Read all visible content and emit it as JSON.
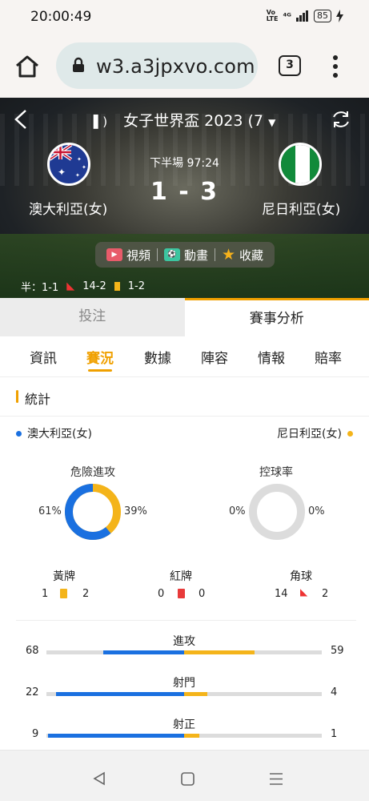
{
  "status_bar": {
    "time": "20:00:49",
    "network": "4G",
    "battery": "85"
  },
  "browser": {
    "url": "w3.a3jpxvo.com",
    "tab_count": "3"
  },
  "match": {
    "league": "女子世界盃 2023 (7",
    "period": "下半場  97:24",
    "home": {
      "name": "澳大利亞(女)"
    },
    "away": {
      "name": "尼日利亞(女)"
    },
    "score": "1 - 3",
    "actions": {
      "video": "視頻",
      "animation": "動畫",
      "favorite": "收藏"
    },
    "summary": {
      "half": "半：1-1",
      "corners": "14-2",
      "cards": "1-2"
    }
  },
  "section_tabs": [
    {
      "label": "投注"
    },
    {
      "label": "賽事分析"
    }
  ],
  "sub_tabs": [
    {
      "label": "資訊"
    },
    {
      "label": "賽況"
    },
    {
      "label": "數據"
    },
    {
      "label": "陣容"
    },
    {
      "label": "情報"
    },
    {
      "label": "賠率"
    }
  ],
  "stats": {
    "title": "統計",
    "home_label": "澳大利亞(女)",
    "away_label": "尼日利亞(女)",
    "danger_attack": {
      "label": "危險進攻",
      "home": "61%",
      "away": "39%",
      "home_frac": 0.61
    },
    "possession": {
      "label": "控球率",
      "home": "0%",
      "away": "0%"
    },
    "yellow": {
      "label": "黃牌",
      "home": "1",
      "away": "2"
    },
    "red": {
      "label": "紅牌",
      "home": "0",
      "away": "0"
    },
    "corner": {
      "label": "角球",
      "home": "14",
      "away": "2"
    },
    "bars": [
      {
        "label": "進攻",
        "home": "68",
        "away": "59",
        "home_v": 68,
        "away_v": 59
      },
      {
        "label": "射門",
        "home": "22",
        "away": "4",
        "home_v": 22,
        "away_v": 4
      },
      {
        "label": "射正",
        "home": "9",
        "away": "1",
        "home_v": 9,
        "away_v": 1
      }
    ]
  },
  "colors": {
    "home": "#1a70e0",
    "away": "#f4b41a",
    "accent": "#f0a000"
  }
}
